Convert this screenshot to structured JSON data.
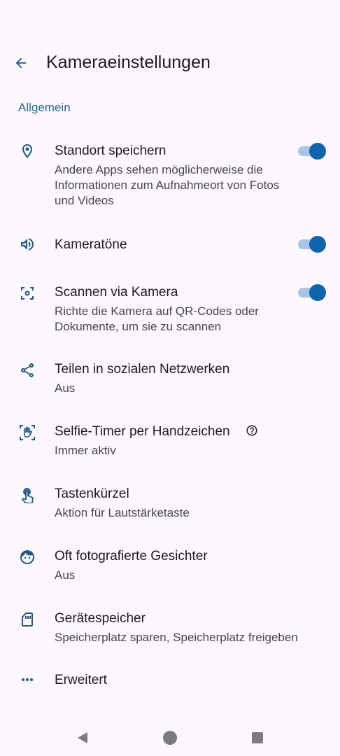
{
  "header": {
    "title": "Kameraeinstellungen",
    "back_icon": "arrow-back-icon"
  },
  "section": {
    "label": "Allgemein"
  },
  "settings": [
    {
      "label": "Standort speichern",
      "sub": "Andere Apps sehen möglicherweise die Informationen zum Aufnahmeort von Fotos und Videos",
      "icon": "location-pin-icon",
      "toggle": true
    },
    {
      "label": "Kameratöne",
      "sub": "",
      "icon": "volume-icon",
      "toggle": true
    },
    {
      "label": "Scannen via Kamera",
      "sub": "Richte die Kamera auf QR-Codes oder Dokumente, um sie zu scannen",
      "icon": "scan-icon",
      "toggle": true
    },
    {
      "label": "Teilen in sozialen Netzwerken",
      "sub": "Aus",
      "icon": "share-icon"
    },
    {
      "label": "Selfie-Timer per Handzeichen",
      "sub": "Immer aktiv",
      "icon": "hand-gesture-icon",
      "help_icon": "help-circle-icon"
    },
    {
      "label": "Tastenkürzel",
      "sub": "Aktion für Lautstärketaste",
      "icon": "touch-icon"
    },
    {
      "label": "Oft fotografierte Gesichter",
      "sub": "Aus",
      "icon": "face-icon"
    },
    {
      "label": "Gerätespeicher",
      "sub": "Speicherplatz sparen, Speicherplatz freigeben",
      "icon": "sd-card-icon"
    },
    {
      "label": "Erweitert",
      "sub": "",
      "icon": "more-dots-icon"
    }
  ],
  "navbar": {
    "back": "nav-back-icon",
    "home": "nav-home-icon",
    "recents": "nav-recents-icon"
  },
  "colors": {
    "accent": "#0f65ad",
    "track": "#a9c5e6",
    "icon": "#1e5a8c",
    "background": "#fbf7fd"
  }
}
